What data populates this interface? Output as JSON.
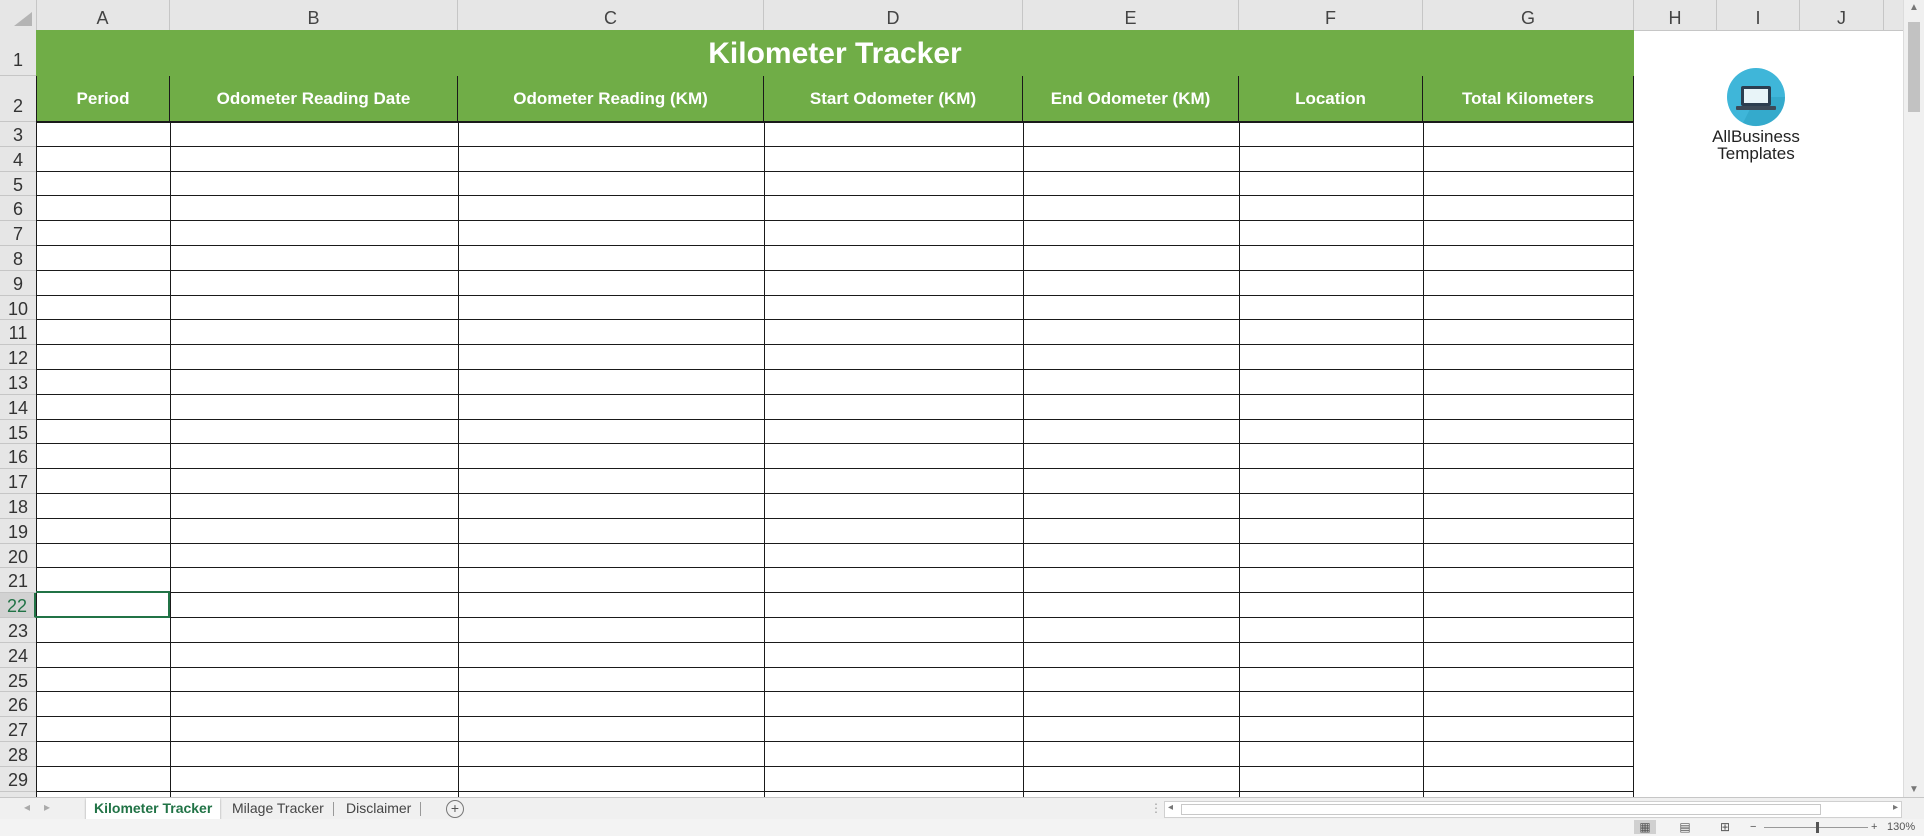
{
  "columns": [
    "A",
    "B",
    "C",
    "D",
    "E",
    "F",
    "G",
    "H",
    "I",
    "J"
  ],
  "rows": [
    "1",
    "2",
    "3",
    "4",
    "5",
    "6",
    "7",
    "8",
    "9",
    "10",
    "11",
    "12",
    "13",
    "14",
    "15",
    "16",
    "17",
    "18",
    "19",
    "20",
    "21",
    "22",
    "23",
    "24",
    "25",
    "26",
    "27",
    "28",
    "29"
  ],
  "active_row": "22",
  "sheet": {
    "title": "Kilometer Tracker",
    "headers": [
      "Period",
      "Odometer Reading Date",
      "Odometer Reading (KM)",
      "Start Odometer (KM)",
      "End Odometer (KM)",
      "Location",
      "Total Kilometers"
    ]
  },
  "logo": {
    "line1": "AllBusiness",
    "line2": "Templates",
    "icon": "laptop-icon"
  },
  "tabs": [
    "Kilometer Tracker",
    "Milage Tracker",
    "Disclaimer"
  ],
  "active_tab": "Kilometer Tracker",
  "zoom": "130%",
  "colors": {
    "green": "#70ad47",
    "excel_green": "#217346"
  }
}
